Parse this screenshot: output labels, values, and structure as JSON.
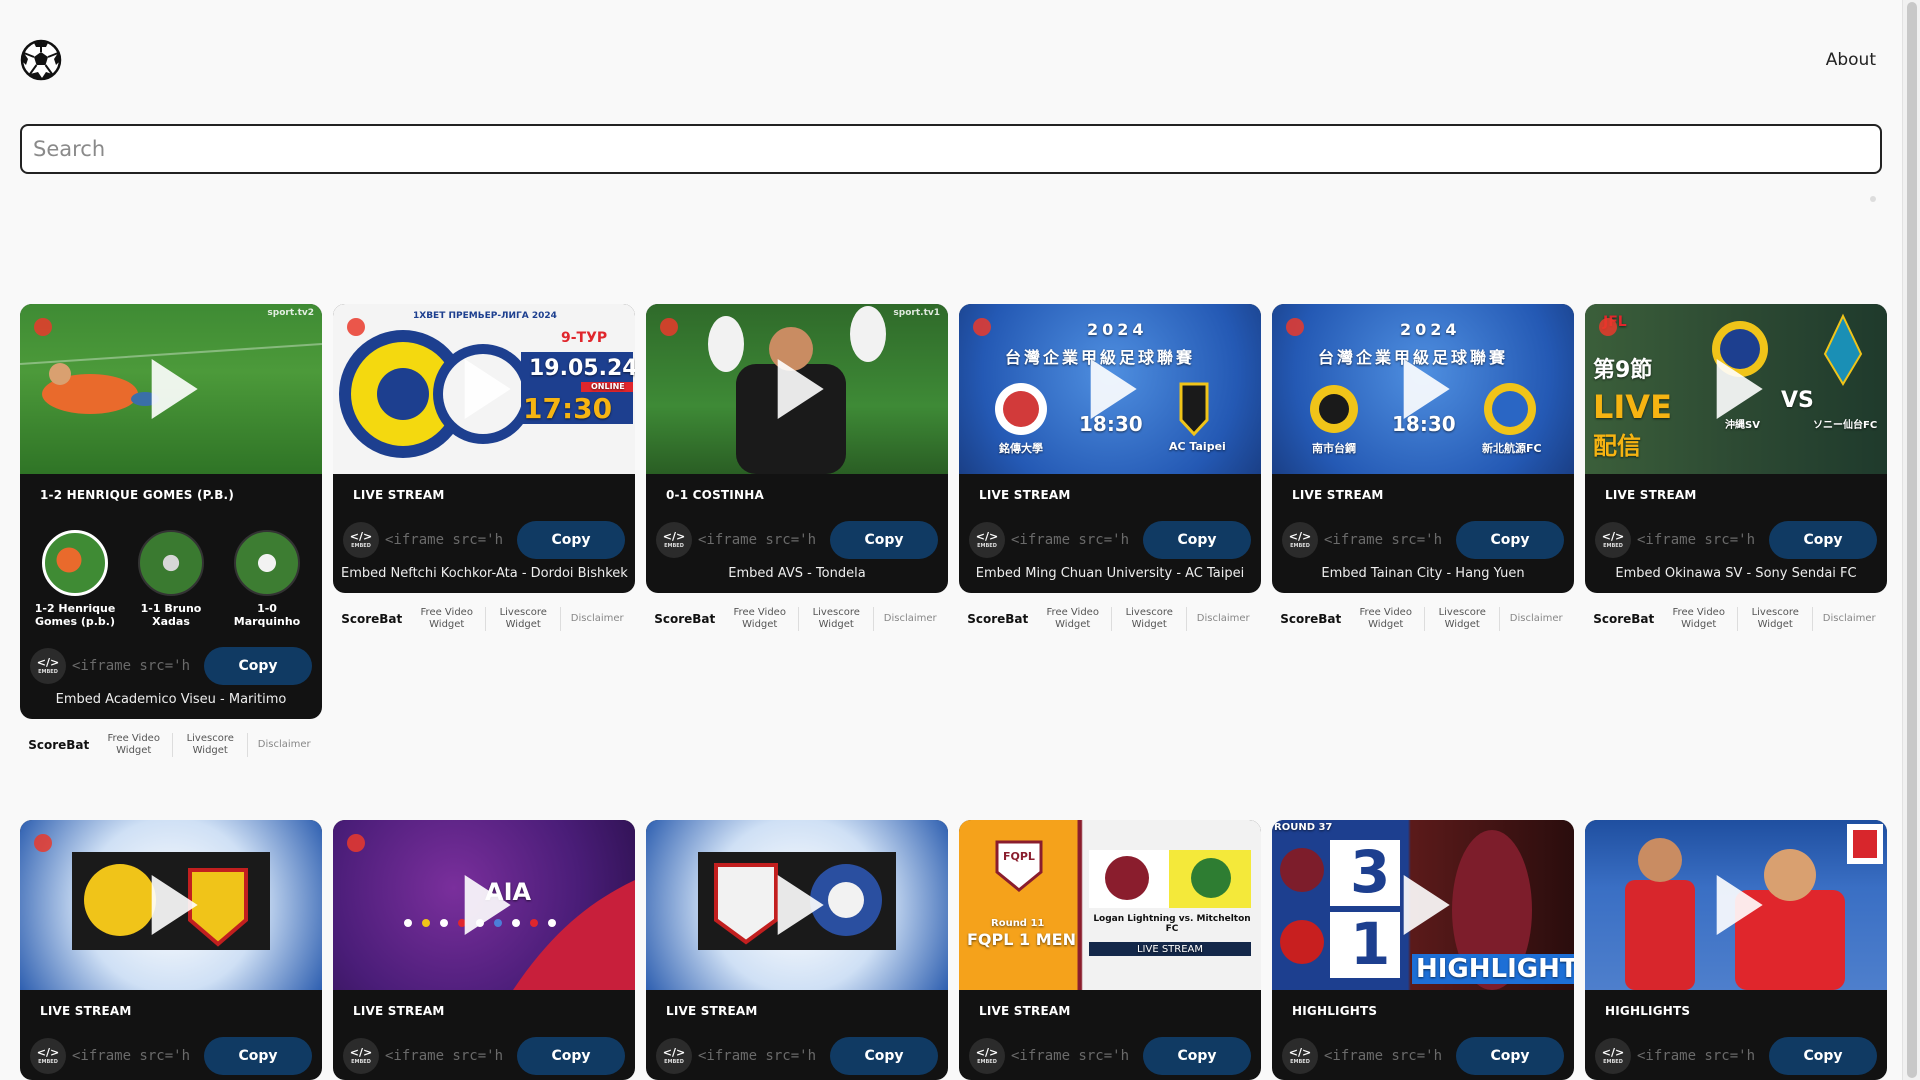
{
  "header": {
    "about_label": "About"
  },
  "search": {
    "placeholder": "Search"
  },
  "footer": {
    "brand": "ScoreBat",
    "free_video": "Free Video Widget",
    "livescore": "Livescore Widget",
    "disclaimer": "Disclaimer"
  },
  "embed": {
    "icon_label": "EMBED",
    "code_snippet": "<iframe src='h",
    "copy_label": "Copy"
  },
  "colors": {
    "copy_button": "#103a63",
    "card_bg": "#121212",
    "live_dot": "#e93a2c"
  },
  "cards_row1": [
    {
      "title": "1-2 HENRIQUE GOMES (P.B.)",
      "caption": "Embed Academico Viseu - Maritimo",
      "goals": [
        {
          "label": "1-2 Henrique Gomes (p.b.)"
        },
        {
          "label": "1-1 Bruno Xadas"
        },
        {
          "label": "1-0 Marquinho"
        }
      ],
      "thumb_tag": "sport.tv2"
    },
    {
      "title": "LIVE STREAM",
      "caption": "Embed Neftchi Kochkor-Ata - Dordoi Bishkek",
      "thumb_texts": {
        "league": "1XBET ПРЕМЬЕР-ЛИГА 2024",
        "round": "9-ТУР",
        "date": "19.05.24",
        "time": "17:30",
        "online": "ONLINE"
      }
    },
    {
      "title": "0-1 COSTINHA",
      "caption": "Embed AVS - Tondela",
      "thumb_tag": "sport.tv1"
    },
    {
      "title": "LIVE STREAM",
      "caption": "Embed Ming Chuan University - AC Taipei",
      "thumb_texts": {
        "year": "2024",
        "league": "台灣企業甲級足球聯賽",
        "time": "18:30",
        "home": "銘傳大學",
        "away": "AC Taipei"
      }
    },
    {
      "title": "LIVE STREAM",
      "caption": "Embed Tainan City - Hang Yuen",
      "thumb_texts": {
        "year": "2024",
        "league": "台灣企業甲級足球聯賽",
        "time": "18:30",
        "home": "南市台鋼",
        "away": "新北航源FC"
      }
    },
    {
      "title": "LIVE STREAM",
      "caption": "Embed Okinawa SV - Sony Sendai FC",
      "thumb_texts": {
        "round": "第9節",
        "live": "LIVE",
        "haishin": "配信",
        "vs": "VS",
        "home": "沖縄SV",
        "away": "ソニー仙台FC",
        "league": "JFL"
      }
    }
  ],
  "cards_row2": [
    {
      "title": "LIVE STREAM"
    },
    {
      "title": "LIVE STREAM",
      "thumb_texts": {
        "sponsor": "AIA"
      }
    },
    {
      "title": "LIVE STREAM"
    },
    {
      "title": "LIVE STREAM",
      "thumb_texts": {
        "league": "FQPL",
        "round": "Round 11",
        "division": "FQPL 1 MEN",
        "match": "Logan Lightning vs. Mitchelton FC",
        "stream": "LIVE STREAM"
      }
    },
    {
      "title": "HIGHLIGHTS",
      "thumb_texts": {
        "round": "ROUND 37",
        "home_score": "3",
        "away_score": "1",
        "banner": "HIGHLIGHTS"
      }
    },
    {
      "title": "HIGHLIGHTS"
    }
  ]
}
